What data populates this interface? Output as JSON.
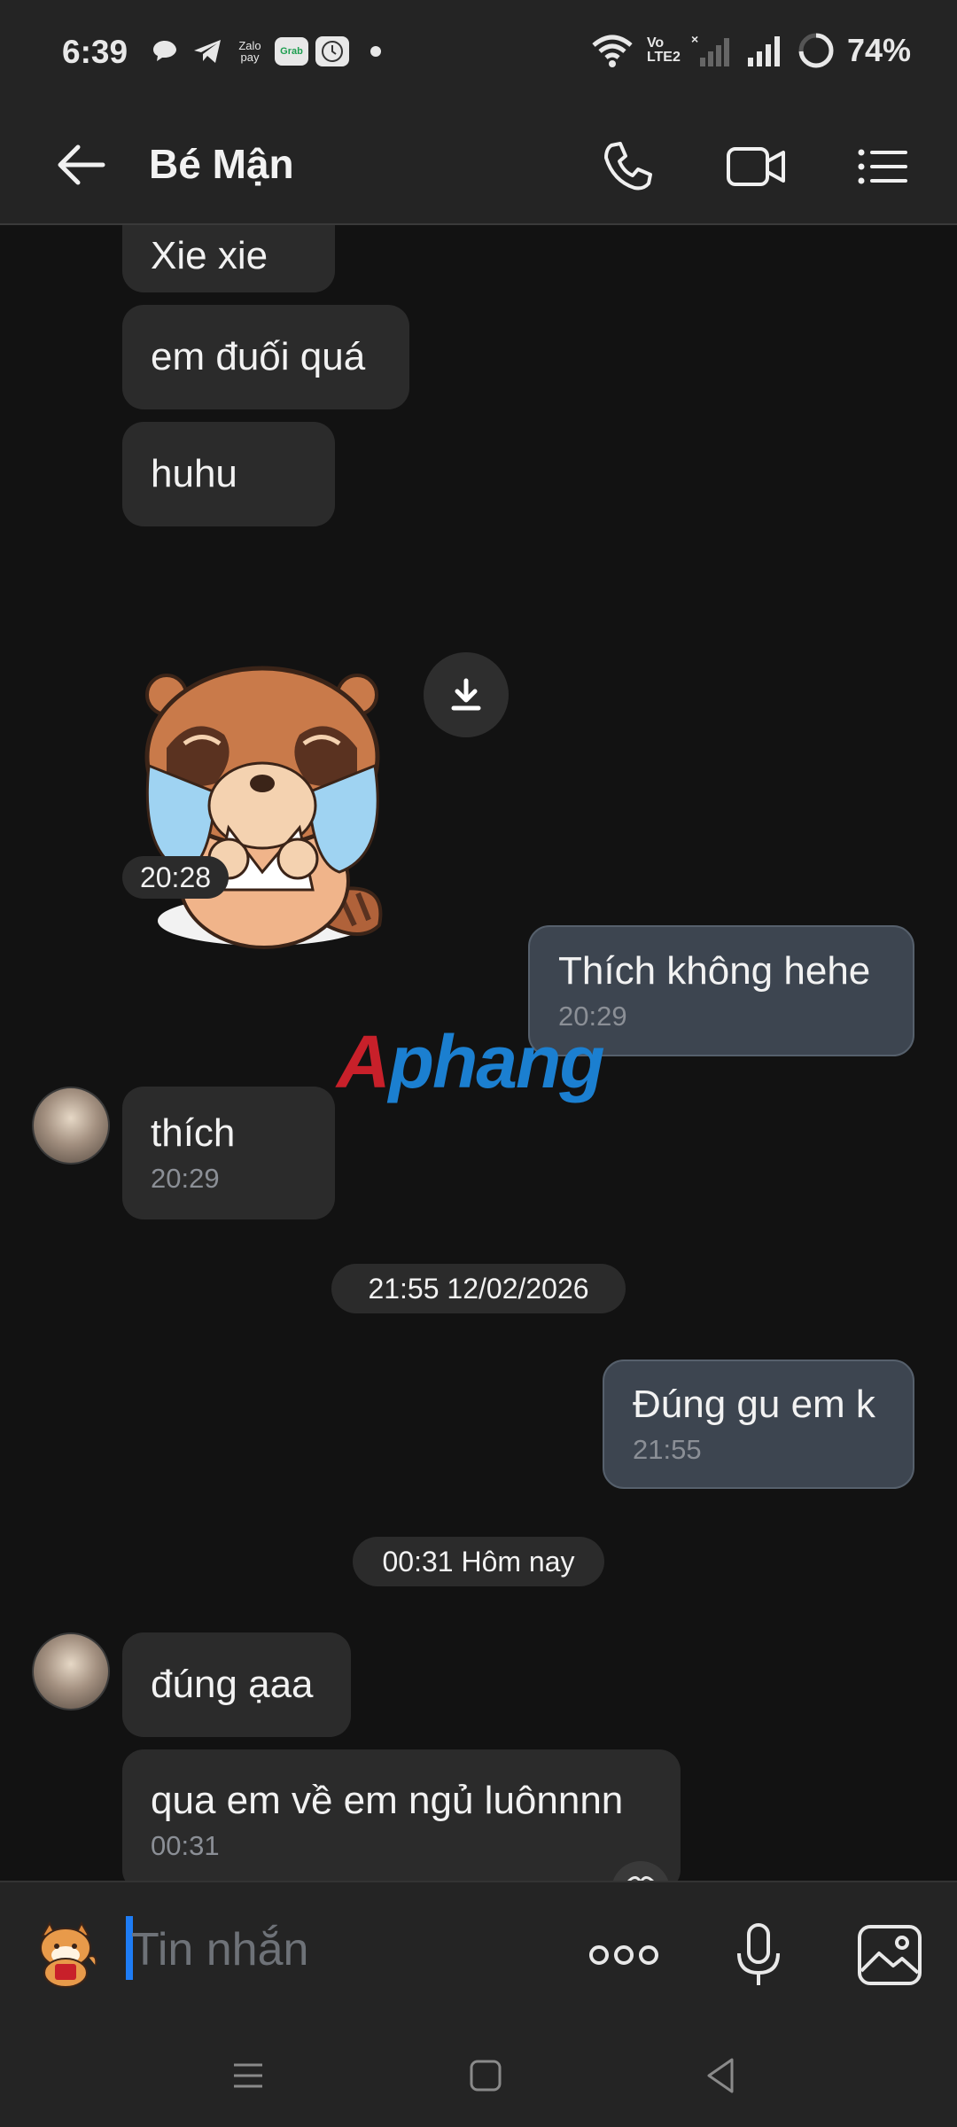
{
  "status_bar": {
    "time": "6:39",
    "battery_percent": "74%",
    "notification_icons": [
      "chat-bubble-icon",
      "telegram-icon",
      "zalopay-icon",
      "grab-icon",
      "clock-app-icon",
      "more-dot-icon"
    ],
    "zalopay_label": "Zalo pay",
    "grab_label": "Grab",
    "volte_label": "Vo LTE2"
  },
  "header": {
    "title": "Bé Mận"
  },
  "messages": [
    {
      "side": "them",
      "text": "Xie xie"
    },
    {
      "side": "them",
      "text": "em đuối quá"
    },
    {
      "side": "them",
      "text": "huhu"
    },
    {
      "side": "them",
      "type": "sticker",
      "sticker": "crying-raccoon"
    },
    {
      "side": "them",
      "type": "time",
      "time": "20:28"
    },
    {
      "side": "me",
      "text": "Thích không hehe",
      "time": "20:29"
    },
    {
      "side": "them",
      "text": "thích",
      "time": "20:29"
    },
    {
      "type": "separator",
      "text": "21:55 12/02/2026"
    },
    {
      "side": "me",
      "text": "Đúng gu em k",
      "time": "21:55"
    },
    {
      "type": "separator",
      "text": "00:31 Hôm nay"
    },
    {
      "side": "them",
      "text": "đúng ạaa"
    },
    {
      "side": "them",
      "text": "qua em về em ngủ luônnnn",
      "time": "00:31"
    }
  ],
  "watermark": {
    "text_a": "A",
    "text_b": "phang"
  },
  "input_bar": {
    "placeholder": "Tin nhắn"
  },
  "colors": {
    "background": "#121212",
    "bar": "#242424",
    "bubble_them": "#2b2b2b",
    "bubble_me": "#3d4550",
    "caret": "#1e7cf5"
  }
}
